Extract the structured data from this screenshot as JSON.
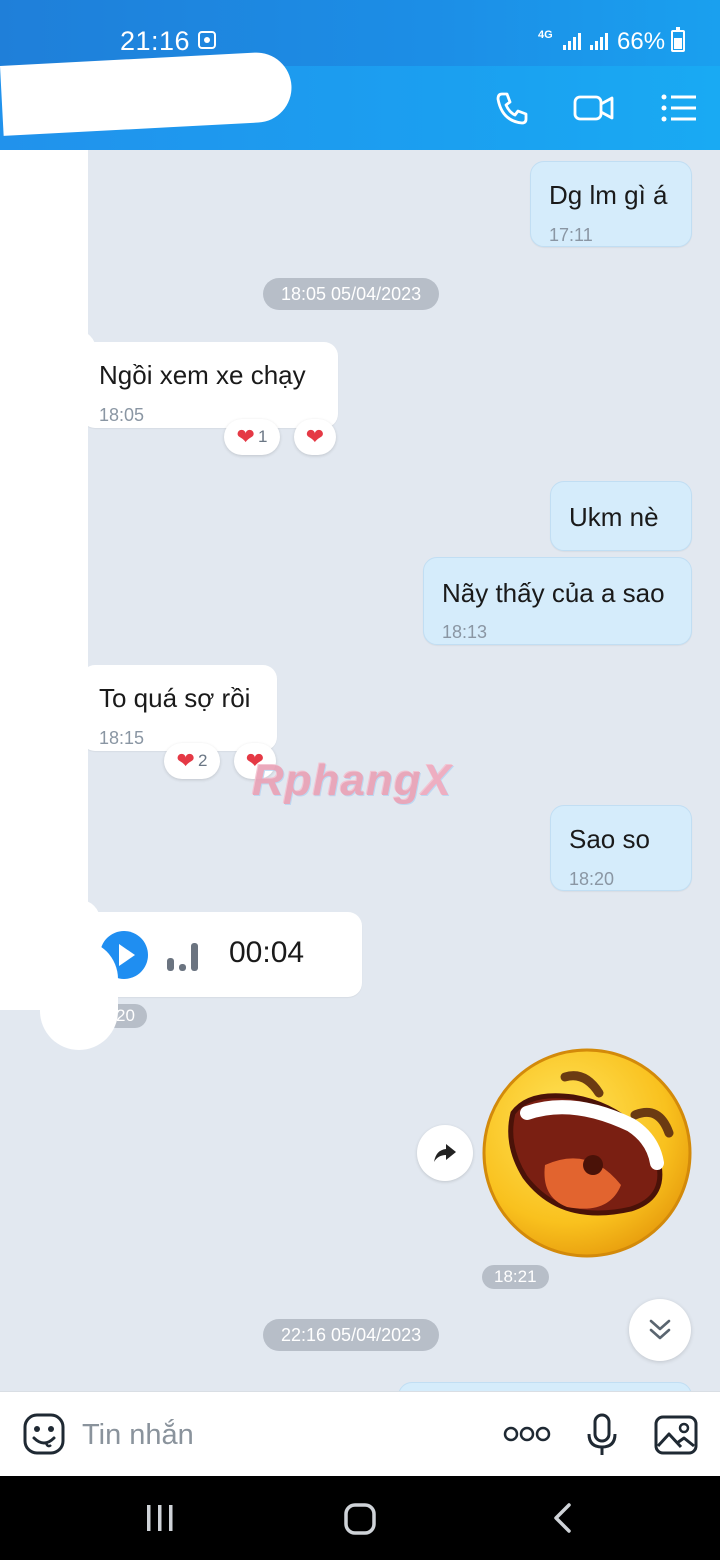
{
  "status_bar": {
    "time": "21:16",
    "network": "4G",
    "battery": "66%"
  },
  "header": {
    "icons": [
      "phone-icon",
      "video-call-icon",
      "menu-list-icon"
    ]
  },
  "messages": [
    {
      "direction": "out",
      "text": "Dg lm gì á",
      "time": "17:11"
    },
    {
      "type": "date",
      "text": "18:05 05/04/2023"
    },
    {
      "direction": "in",
      "text": "Ngồi xem xe chạy",
      "time": "18:05",
      "reactions": [
        {
          "emoji": "heart",
          "count": "1"
        },
        {
          "emoji": "heart",
          "count": ""
        }
      ]
    },
    {
      "direction": "out",
      "text": "Ukm nè"
    },
    {
      "direction": "out",
      "text": "Nãy thấy của a sao",
      "time": "18:13"
    },
    {
      "direction": "in",
      "text": "To quá sợ rồi",
      "time": "18:15",
      "reactions": [
        {
          "emoji": "heart",
          "count": "2"
        },
        {
          "emoji": "heart",
          "count": ""
        }
      ]
    },
    {
      "direction": "out",
      "text": "Sao so",
      "time": "18:20"
    },
    {
      "direction": "in",
      "type": "voice",
      "duration": "00:04",
      "time": "20"
    },
    {
      "direction": "out",
      "type": "sticker",
      "sticker": "laughing-face",
      "time": "18:21"
    },
    {
      "type": "date",
      "text": "22:16 05/04/2023"
    }
  ],
  "watermark": {
    "main": "Rphang",
    "tail": "X"
  },
  "input": {
    "placeholder": "Tin nhắn"
  },
  "colors": {
    "header_blue": "#1c9bef",
    "outgoing_bubble": "#d5ecfb",
    "incoming_bubble": "#ffffff",
    "chat_background": "#e2e8f0",
    "heart": "#e53945",
    "play_blue": "#1f8ef1"
  }
}
